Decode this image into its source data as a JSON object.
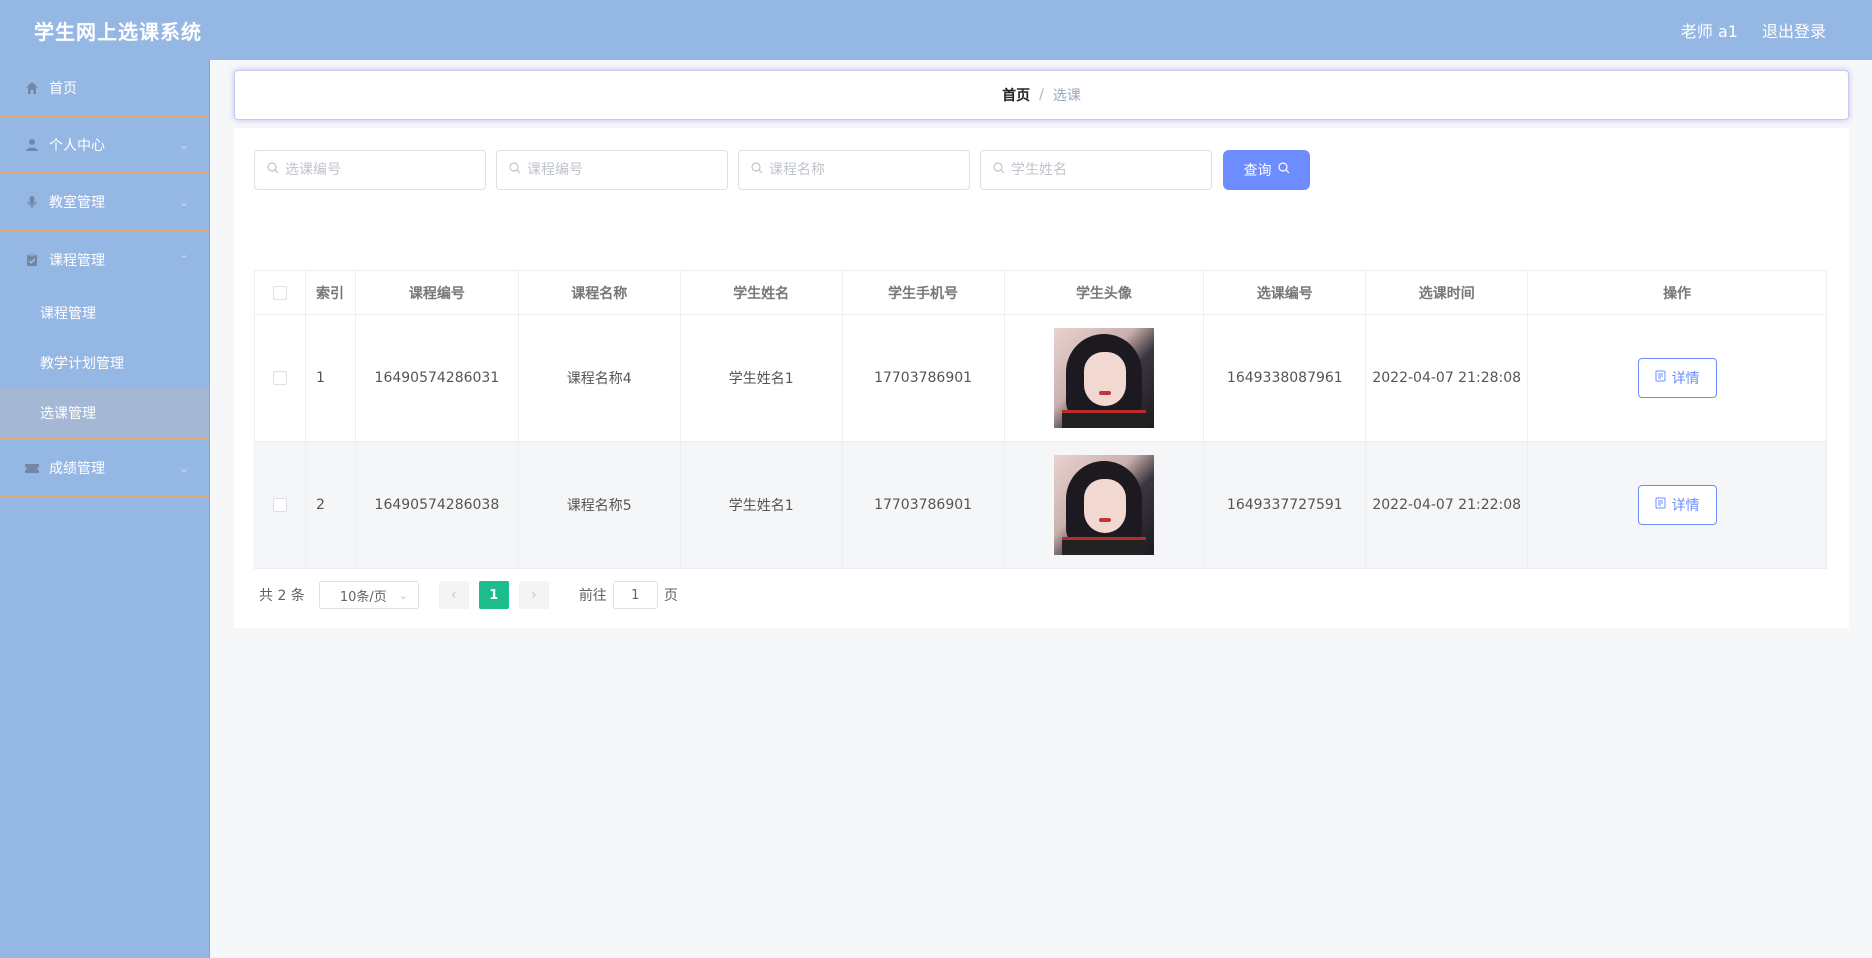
{
  "header": {
    "title": "学生网上选课系统",
    "user": "老师 a1",
    "logout": "退出登录"
  },
  "sidebar": {
    "items": [
      {
        "label": "首页",
        "icon": "home-icon"
      },
      {
        "label": "个人中心",
        "icon": "user-icon"
      },
      {
        "label": "教室管理",
        "icon": "mic-icon"
      },
      {
        "label": "课程管理",
        "icon": "clipboard-icon"
      },
      {
        "label": "成绩管理",
        "icon": "ticket-icon"
      }
    ],
    "submenu": [
      "课程管理",
      "教学计划管理",
      "选课管理"
    ],
    "active_submenu": "选课管理"
  },
  "breadcrumb": {
    "home": "首页",
    "separator": "/",
    "current": "选课"
  },
  "search": {
    "placeholders": [
      "选课编号",
      "课程编号",
      "课程名称",
      "学生姓名"
    ],
    "button": "查询"
  },
  "table": {
    "headers": [
      "索引",
      "课程编号",
      "课程名称",
      "学生姓名",
      "学生手机号",
      "学生头像",
      "选课编号",
      "选课时间",
      "操作"
    ],
    "rows": [
      {
        "index": "1",
        "course_no": "16490574286031",
        "course_name": "课程名称4",
        "student_name": "学生姓名1",
        "phone": "17703786901",
        "selection_no": "1649338087961",
        "time": "2022-04-07 21:28:08",
        "action": "详情"
      },
      {
        "index": "2",
        "course_no": "16490574286038",
        "course_name": "课程名称5",
        "student_name": "学生姓名1",
        "phone": "17703786901",
        "selection_no": "1649337727591",
        "time": "2022-04-07 21:22:08",
        "action": "详情"
      }
    ]
  },
  "pagination": {
    "total": "共 2 条",
    "page_size": "10条/页",
    "current_page": "1",
    "goto_label": "前往",
    "goto_value": "1",
    "page_suffix": "页"
  },
  "colors": {
    "header_bg": "#95b7e3",
    "accent": "#6c8cff",
    "page_active": "#1cbc8c"
  }
}
